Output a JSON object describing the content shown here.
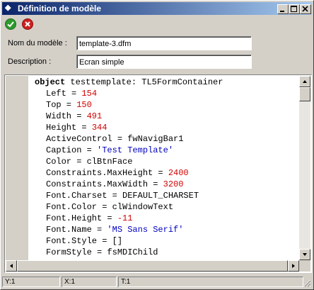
{
  "window": {
    "title": "Définition de modèle",
    "controls": {
      "minimize_icon": "minimize-icon",
      "maximize_icon": "maximize-icon",
      "close_icon": "close-icon"
    }
  },
  "toolbar": {
    "ok_icon": "green-check-icon",
    "cancel_icon": "red-x-icon",
    "colors": {
      "ok": "#2f9a2f",
      "cancel": "#cc2020"
    }
  },
  "form": {
    "model_name_label": "Nom du modèle :",
    "model_name_value": "template-3.dfm",
    "description_label": "Description :",
    "description_value": "Ecran simple"
  },
  "editor": {
    "colors": {
      "number": "#d00000",
      "string": "#0000c0"
    },
    "lines": [
      {
        "indent": 0,
        "parts": [
          {
            "t": "object",
            "c": "kw"
          },
          {
            "t": " testtemplate: TL5FormContainer",
            "c": ""
          }
        ]
      },
      {
        "indent": 1,
        "parts": [
          {
            "t": "Left = ",
            "c": ""
          },
          {
            "t": "154",
            "c": "num"
          }
        ]
      },
      {
        "indent": 1,
        "parts": [
          {
            "t": "Top = ",
            "c": ""
          },
          {
            "t": "150",
            "c": "num"
          }
        ]
      },
      {
        "indent": 1,
        "parts": [
          {
            "t": "Width = ",
            "c": ""
          },
          {
            "t": "491",
            "c": "num"
          }
        ]
      },
      {
        "indent": 1,
        "parts": [
          {
            "t": "Height = ",
            "c": ""
          },
          {
            "t": "344",
            "c": "num"
          }
        ]
      },
      {
        "indent": 1,
        "parts": [
          {
            "t": "ActiveControl = fwNavigBar1",
            "c": ""
          }
        ]
      },
      {
        "indent": 1,
        "parts": [
          {
            "t": "Caption = ",
            "c": ""
          },
          {
            "t": "'Test Template'",
            "c": "str"
          }
        ]
      },
      {
        "indent": 1,
        "parts": [
          {
            "t": "Color = clBtnFace",
            "c": ""
          }
        ]
      },
      {
        "indent": 1,
        "parts": [
          {
            "t": "Constraints.MaxHeight = ",
            "c": ""
          },
          {
            "t": "2400",
            "c": "num"
          }
        ]
      },
      {
        "indent": 1,
        "parts": [
          {
            "t": "Constraints.MaxWidth = ",
            "c": ""
          },
          {
            "t": "3200",
            "c": "num"
          }
        ]
      },
      {
        "indent": 1,
        "parts": [
          {
            "t": "Font.Charset = DEFAULT_CHARSET",
            "c": ""
          }
        ]
      },
      {
        "indent": 1,
        "parts": [
          {
            "t": "Font.Color = clWindowText",
            "c": ""
          }
        ]
      },
      {
        "indent": 1,
        "parts": [
          {
            "t": "Font.Height = ",
            "c": ""
          },
          {
            "t": "-11",
            "c": "num"
          }
        ]
      },
      {
        "indent": 1,
        "parts": [
          {
            "t": "Font.Name = ",
            "c": ""
          },
          {
            "t": "'MS Sans Serif'",
            "c": "str"
          }
        ]
      },
      {
        "indent": 1,
        "parts": [
          {
            "t": "Font.Style = []",
            "c": ""
          }
        ]
      },
      {
        "indent": 1,
        "parts": [
          {
            "t": "FormStyle = fsMDIChild",
            "c": ""
          }
        ]
      }
    ]
  },
  "statusbar": {
    "y": "Y:1",
    "x": "X:1",
    "t": "T:1"
  }
}
